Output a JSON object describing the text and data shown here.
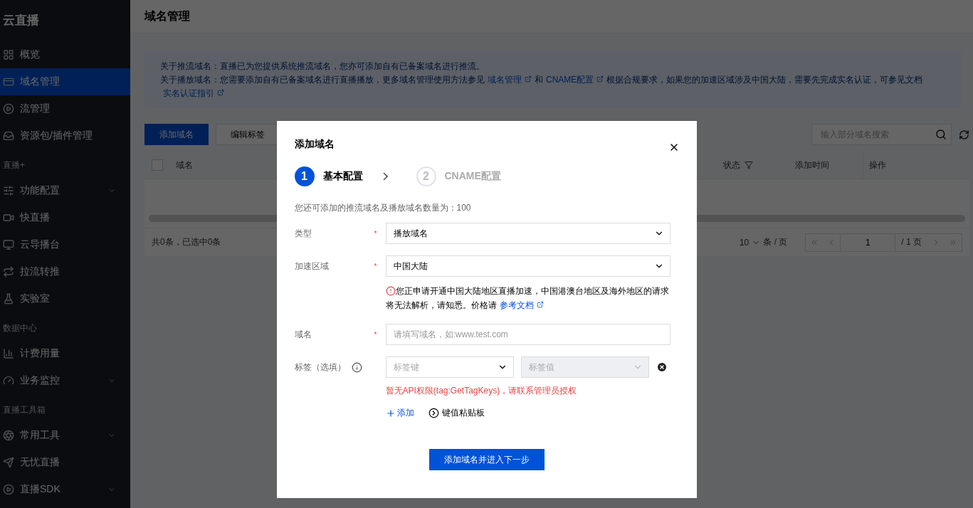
{
  "sidebar": {
    "title": "云直播",
    "sections": [
      {
        "items": [
          {
            "label": "概览",
            "selected": false,
            "expandable": false
          },
          {
            "label": "域名管理",
            "selected": true,
            "expandable": false
          },
          {
            "label": "流管理",
            "selected": false,
            "expandable": false
          },
          {
            "label": "资源包/插件管理",
            "selected": false,
            "expandable": false
          }
        ]
      },
      {
        "heading": "直播+",
        "items": [
          {
            "label": "功能配置",
            "selected": false,
            "expandable": true
          },
          {
            "label": "快直播",
            "selected": false,
            "expandable": false
          },
          {
            "label": "云导播台",
            "selected": false,
            "expandable": false
          },
          {
            "label": "拉流转推",
            "selected": false,
            "expandable": false
          },
          {
            "label": "实验室",
            "selected": false,
            "expandable": false
          }
        ]
      },
      {
        "heading": "数据中心",
        "items": [
          {
            "label": "计费用量",
            "selected": false,
            "expandable": false
          },
          {
            "label": "业务监控",
            "selected": false,
            "expandable": true
          }
        ]
      },
      {
        "heading": "直播工具箱",
        "items": [
          {
            "label": "常用工具",
            "selected": false,
            "expandable": true
          },
          {
            "label": "无忧直播",
            "selected": false,
            "expandable": false
          },
          {
            "label": "直播SDK",
            "selected": false,
            "expandable": true
          }
        ]
      }
    ]
  },
  "header": {
    "title": "域名管理"
  },
  "notice": {
    "lines": [
      [
        {
          "kind": "text",
          "text": "关于推流域名：直播已为您提供系统推流域名，您亦可添加自有已备案域名进行推流。"
        }
      ],
      [
        {
          "kind": "text",
          "text": "关于播放域名：您需要添加自有已备案域名进行直播播放，更多域名管理使用方法参见"
        },
        {
          "kind": "link",
          "text": "域名管理"
        },
        {
          "kind": "text",
          "text": "和"
        },
        {
          "kind": "link",
          "text": "CNAME配置"
        },
        {
          "kind": "text",
          "text": "根据合规要求，如果您的加速区域涉及中国大陆，需要先完成实名认证，可参见文档"
        },
        {
          "kind": "link",
          "text": "实名认证指引"
        }
      ]
    ]
  },
  "toolbar": {
    "buttons": [
      {
        "label": "添加域名",
        "primary": true
      },
      {
        "label": "编辑标签",
        "primary": false
      }
    ],
    "search": {
      "placeholder": "输入部分域名搜索"
    }
  },
  "table": {
    "select_all": {
      "checked": false
    },
    "columns": [
      {
        "label": "域名",
        "filter": false
      },
      {
        "label": "状态",
        "filter": true
      },
      {
        "label": "添加时间",
        "filter": false
      },
      {
        "label": "操作",
        "filter": false
      }
    ],
    "footer": {
      "summary": "共0条，已选中0条",
      "page_size": "10",
      "page_size_unit": "条 / 页",
      "page": "1",
      "page_total": "/ 1 页"
    }
  },
  "modal": {
    "title": "添加域名",
    "required_mark": "*",
    "steps": [
      {
        "number": "1",
        "label": "基本配置",
        "selected": true
      },
      {
        "number": "2",
        "label": "CNAME配置",
        "selected": false
      }
    ],
    "quota": "您还可添加的推流域名及播放域名数量为：100",
    "fields": [
      {
        "kind": "select",
        "label": "类型",
        "required": true,
        "value": "播放域名"
      },
      {
        "kind": "select",
        "label": "加速区域",
        "required": true,
        "value": "中国大陆",
        "warning": [
          {
            "kind": "text",
            "text": "您正申请开通中国大陆地区直播加速，中国港澳台地区及海外地区的请求将无法解析，请知悉。价格请"
          },
          {
            "kind": "link",
            "text": "参考文档"
          }
        ]
      },
      {
        "kind": "input",
        "label": "域名",
        "required": true,
        "placeholder": "请填写域名，如:www.test.com"
      },
      {
        "kind": "tags",
        "label": "标签（选填）",
        "required": false,
        "key_placeholder": "标签键",
        "value_placeholder": "标签值",
        "value_disabled": true,
        "error": "暂无API权限(tag:GetTagKeys)，请联系管理员授权",
        "add": "添加",
        "clipboard": "键值粘贴板"
      }
    ],
    "submit": "添加域名并进入下一步"
  }
}
